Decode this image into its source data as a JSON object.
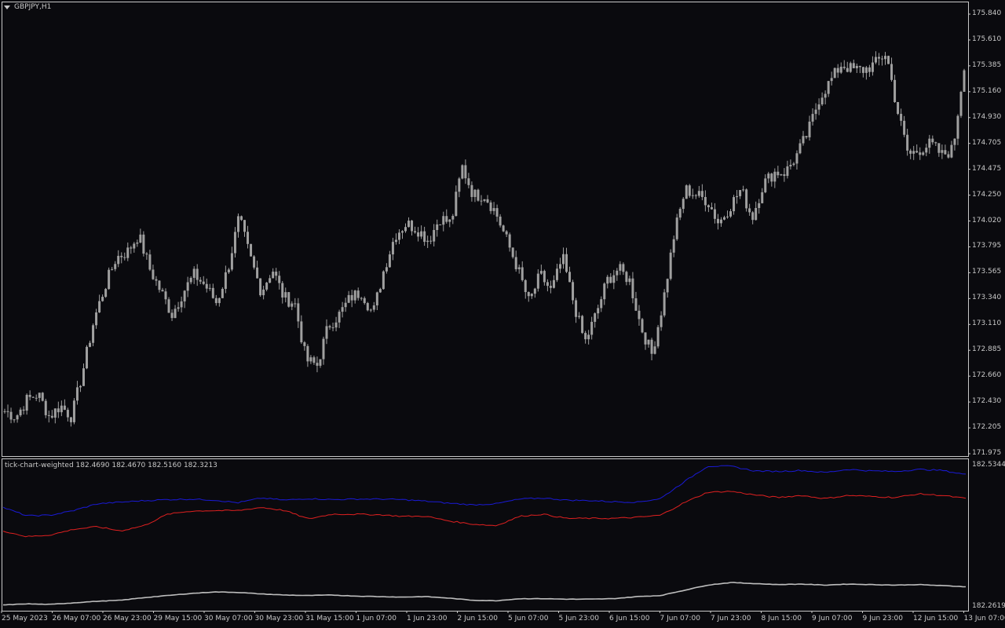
{
  "header": {
    "symbol": "GBPJPY,H1"
  },
  "indicator": {
    "label": "tick-chart-weighted 182.4690 182.4670 182.5160 182.3213",
    "scale_labels": [
      "182.5344",
      "182.2619"
    ],
    "series": [
      {
        "name": "blue",
        "color": "#1a1ad6"
      },
      {
        "name": "red",
        "color": "#e02020"
      },
      {
        "name": "gray",
        "color": "#bdbdbd"
      }
    ]
  },
  "price_axis": {
    "labels": [
      "175.840",
      "175.610",
      "175.385",
      "175.160",
      "174.930",
      "174.705",
      "174.475",
      "174.250",
      "174.020",
      "173.795",
      "173.565",
      "173.340",
      "173.110",
      "172.885",
      "172.660",
      "172.430",
      "172.205",
      "171.975"
    ]
  },
  "time_axis": {
    "labels": [
      "25 May 2023",
      "26 May 07:00",
      "26 May 23:00",
      "29 May 15:00",
      "30 May 07:00",
      "30 May 23:00",
      "31 May 15:00",
      "1 Jun 07:00",
      "1 Jun 23:00",
      "2 Jun 15:00",
      "5 Jun 07:00",
      "5 Jun 23:00",
      "6 Jun 15:00",
      "7 Jun 07:00",
      "7 Jun 23:00",
      "8 Jun 15:00",
      "9 Jun 07:00",
      "9 Jun 23:00",
      "12 Jun 15:00",
      "13 Jun 07:00"
    ]
  },
  "colors": {
    "background": "#0a0a0e",
    "frame": "#c8c8c8",
    "candle": "#a0a0a0",
    "text": "#c8c8c8"
  },
  "chart_data": {
    "type": "candlestick",
    "symbol": "GBPJPY",
    "timeframe": "H1",
    "ylim": [
      171.975,
      175.84
    ],
    "anchors": [
      172.35,
      172.3,
      172.45,
      172.5,
      172.3,
      172.4,
      172.3,
      172.7,
      173.15,
      173.45,
      173.7,
      173.75,
      173.9,
      173.6,
      173.4,
      173.2,
      173.4,
      173.55,
      173.45,
      173.3,
      173.6,
      174.05,
      173.7,
      173.4,
      173.6,
      173.35,
      173.3,
      172.8,
      172.75,
      173.1,
      173.2,
      173.35,
      173.4,
      173.2,
      173.6,
      173.9,
      174.0,
      173.95,
      173.85,
      174.05,
      174.0,
      174.5,
      174.25,
      174.25,
      174.1,
      173.85,
      173.6,
      173.3,
      173.55,
      173.4,
      173.7,
      173.3,
      172.95,
      173.2,
      173.5,
      173.6,
      173.5,
      173.1,
      172.85,
      173.3,
      173.9,
      174.3,
      174.25,
      174.2,
      174.0,
      174.15,
      174.3,
      174.05,
      174.35,
      174.45,
      174.45,
      174.6,
      174.8,
      175.1,
      175.25,
      175.4,
      175.35,
      175.35,
      175.4,
      175.5,
      175.0,
      174.6,
      174.65,
      174.7,
      174.6,
      174.65,
      175.4
    ],
    "indicator_series": [
      {
        "name": "blue",
        "color": "#1a1ad6",
        "values": [
          182.451,
          182.435,
          182.436,
          182.445,
          182.458,
          182.461,
          182.464,
          182.466,
          182.467,
          182.465,
          182.46,
          182.469,
          182.465,
          182.468,
          182.466,
          182.467,
          182.467,
          182.466,
          182.463,
          182.459,
          182.456,
          182.458,
          182.467,
          182.469,
          182.465,
          182.464,
          182.462,
          182.461,
          182.468,
          182.5,
          182.53,
          182.53,
          182.521,
          182.52,
          182.522,
          182.518,
          182.524,
          182.521,
          182.52,
          182.524,
          182.522,
          182.514
        ]
      },
      {
        "name": "red",
        "color": "#e02020",
        "values": [
          182.406,
          182.395,
          182.398,
          182.409,
          182.414,
          182.406,
          182.416,
          182.438,
          182.444,
          182.445,
          182.445,
          182.451,
          182.445,
          182.429,
          182.438,
          182.438,
          182.437,
          182.434,
          182.434,
          182.425,
          182.419,
          182.416,
          182.434,
          182.438,
          182.43,
          182.43,
          182.43,
          182.432,
          182.436,
          182.46,
          182.48,
          182.482,
          182.475,
          182.47,
          182.474,
          182.468,
          182.474,
          182.472,
          182.47,
          182.477,
          182.474,
          182.468
        ]
      },
      {
        "name": "gray",
        "color": "#bdbdbd",
        "values": [
          182.264,
          182.266,
          182.265,
          182.268,
          182.271,
          182.273,
          182.278,
          182.282,
          182.286,
          182.289,
          182.288,
          182.285,
          182.283,
          182.282,
          182.283,
          182.281,
          182.28,
          182.279,
          182.28,
          182.277,
          182.273,
          182.272,
          182.276,
          182.276,
          182.275,
          182.275,
          182.276,
          182.28,
          182.282,
          182.292,
          182.302,
          182.307,
          182.305,
          182.303,
          182.304,
          182.302,
          182.304,
          182.303,
          182.302,
          182.303,
          182.301,
          182.299
        ]
      }
    ],
    "indicator_ylim": [
      182.2619,
      182.5344
    ]
  }
}
